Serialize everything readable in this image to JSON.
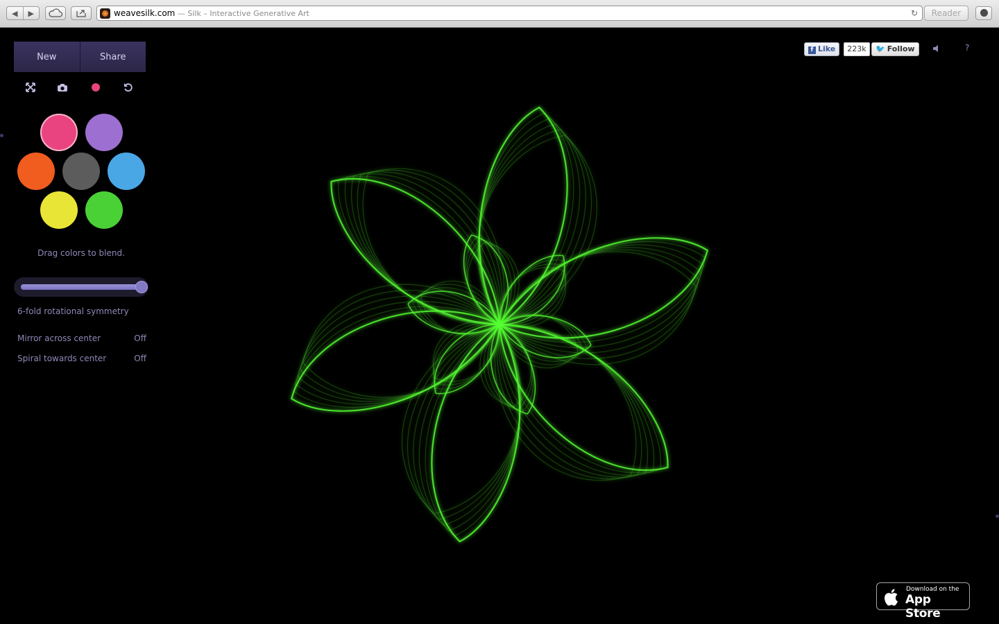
{
  "browser": {
    "domain": "weavesilk.com",
    "title_sep": " — ",
    "page_title": "Silk – Interactive Generative Art",
    "reader_label": "Reader",
    "back_glyph": "◀",
    "forward_glyph": "▶",
    "reload_glyph": "↻"
  },
  "panel": {
    "new_label": "New",
    "share_label": "Share",
    "tools": [
      "fullscreen-icon",
      "camera-icon",
      "record-icon",
      "undo-icon"
    ],
    "tool_glyphs": [
      "⤢",
      "📷",
      "",
      "↺"
    ],
    "swatches": [
      {
        "name": "pink",
        "color": "#e9447f",
        "selected": true
      },
      {
        "name": "purple",
        "color": "#9d6fd0",
        "selected": false
      },
      {
        "name": "orange",
        "color": "#f15c1f",
        "selected": false
      },
      {
        "name": "gray",
        "color": "#5c5c5c",
        "selected": false
      },
      {
        "name": "blue",
        "color": "#4aa7e6",
        "selected": false
      },
      {
        "name": "yellow",
        "color": "#e9e536",
        "selected": false
      },
      {
        "name": "green",
        "color": "#4ad136",
        "selected": false
      }
    ],
    "blend_hint": "Drag colors to blend.",
    "symmetry_value": 1.0,
    "symmetry_label": "6-fold rotational symmetry",
    "options": [
      {
        "label": "Mirror across center",
        "value": "Off"
      },
      {
        "label": "Spiral towards center",
        "value": "Off"
      }
    ]
  },
  "social": {
    "like_label": "Like",
    "like_count": "223k",
    "follow_label": "Follow",
    "help_label": "?"
  },
  "appstore": {
    "small": "Download on the",
    "big": "App Store"
  },
  "drawing": {
    "stroke_color": "#55ff33",
    "folds": 6
  }
}
